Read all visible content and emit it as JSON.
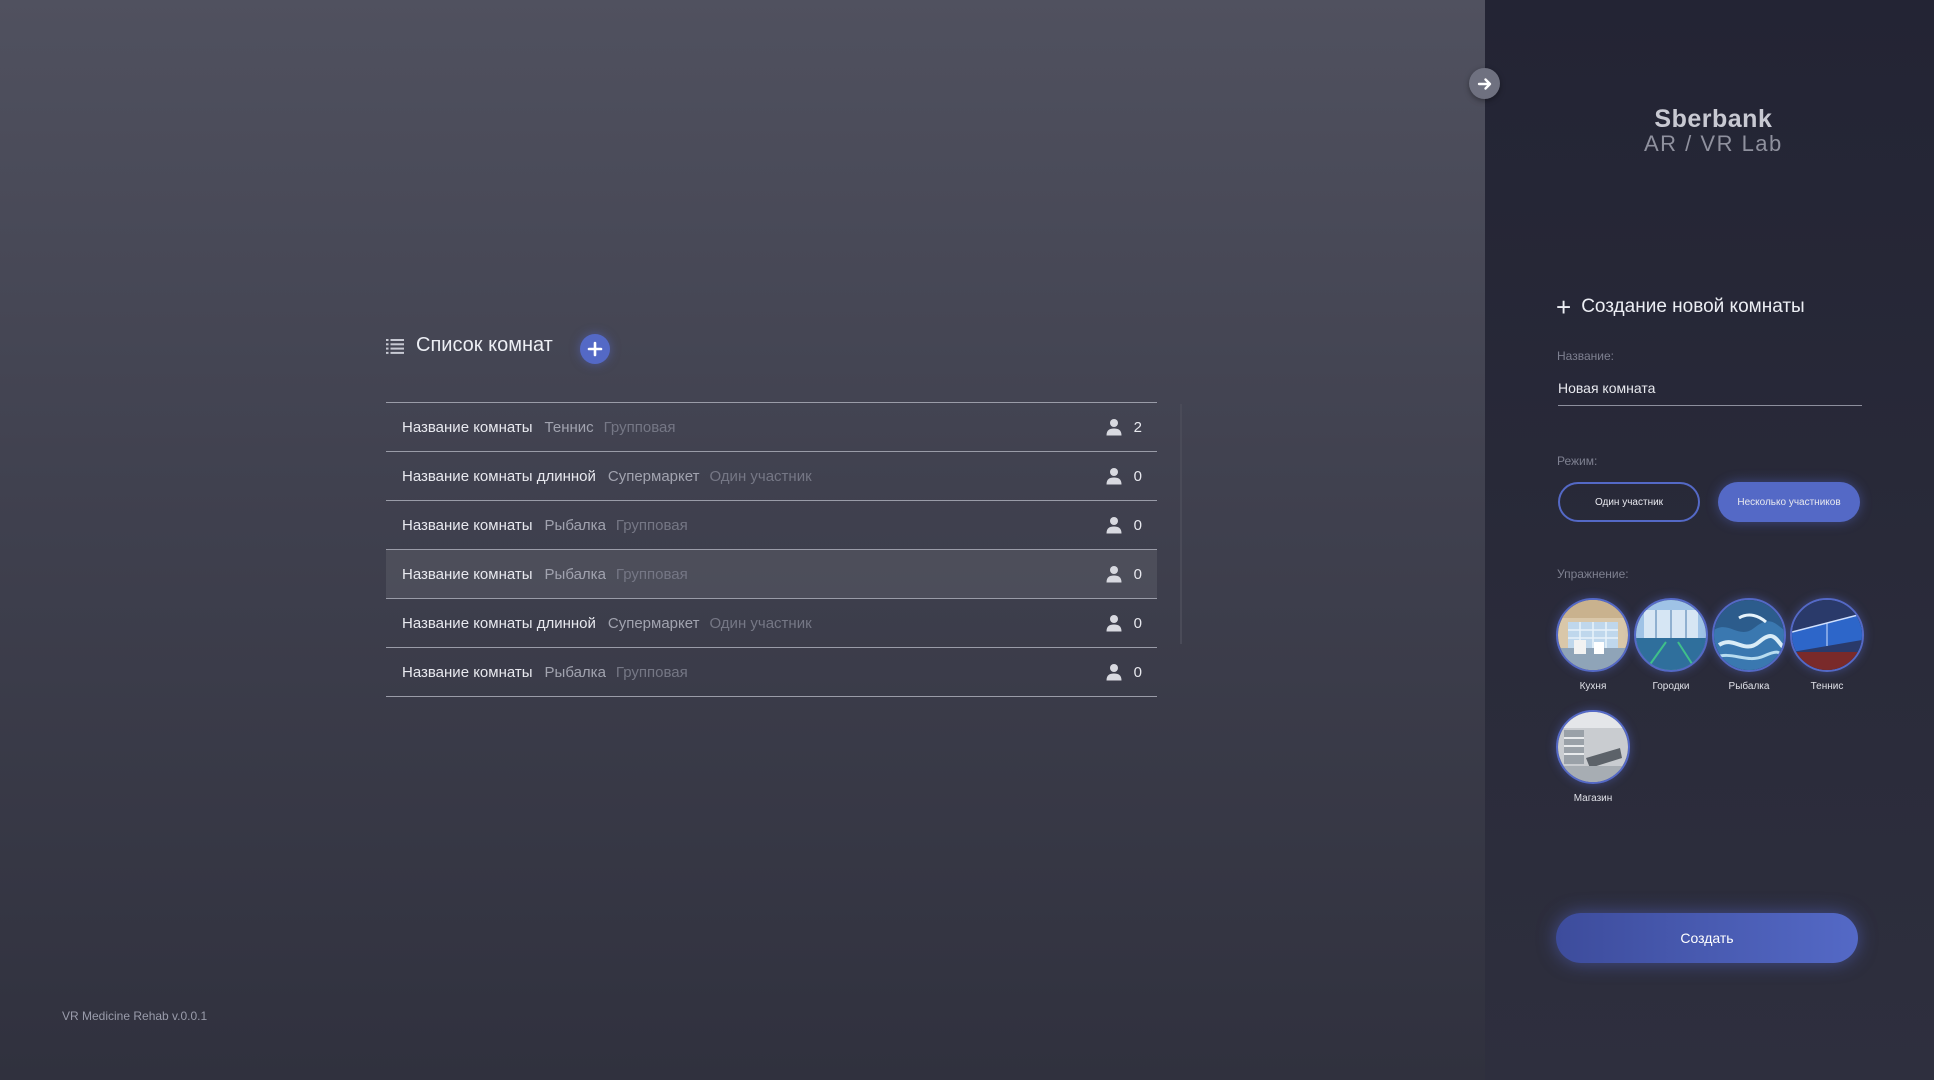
{
  "logo": {
    "line1": "Sberbank",
    "line2": "AR / VR  Lab"
  },
  "room_list": {
    "title": "Список комнат",
    "rooms": [
      {
        "name": "Название комнаты",
        "type": "Теннис",
        "mode": "Групповая",
        "count": "2"
      },
      {
        "name": "Название комнаты длинной",
        "type": "Супермаркет",
        "mode": "Один участник",
        "count": "0"
      },
      {
        "name": "Название комнаты",
        "type": "Рыбалка",
        "mode": "Групповая",
        "count": "0"
      },
      {
        "name": "Название комнаты",
        "type": "Рыбалка",
        "mode": "Групповая",
        "count": "0"
      },
      {
        "name": "Название комнаты длинной",
        "type": "Супермаркет",
        "mode": "Один участник",
        "count": "0"
      },
      {
        "name": "Название комнаты",
        "type": "Рыбалка",
        "mode": "Групповая",
        "count": "0"
      }
    ]
  },
  "version": "VR Medicine Rehab v.0.0.1",
  "create_panel": {
    "title": "Создание новой комнаты",
    "name_label": "Название:",
    "name_value": "Новая комната",
    "mode_label": "Режим:",
    "mode_options": [
      "Один участник",
      "Несколько участников"
    ],
    "mode_selected": "Несколько участников",
    "exercise_label": "Упражнение:",
    "exercises": [
      "Кухня",
      "Городки",
      "Рыбалка",
      "Теннис",
      "Магазин"
    ],
    "create_button": "Создать"
  },
  "colors": {
    "accent": "#5469c6",
    "panel_bg": "#252636",
    "main_bg": "#454655"
  }
}
